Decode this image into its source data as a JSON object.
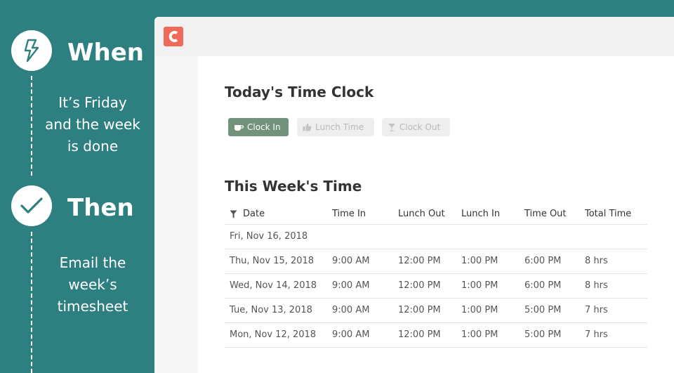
{
  "steps": [
    {
      "title": "When",
      "icon": "lightning-bolt-icon",
      "description": [
        "It’s Friday",
        "and the week",
        "is done"
      ]
    },
    {
      "title": "Then",
      "icon": "checkmark-icon",
      "description": [
        "Email the",
        "week’s",
        "timesheet"
      ]
    }
  ],
  "app": {
    "logo": "app-logo",
    "accent_color": "#f06a5b"
  },
  "today": {
    "title": "Today's Time Clock",
    "buttons": [
      {
        "label": "Clock In",
        "icon": "coffee-cup-icon",
        "enabled": true
      },
      {
        "label": "Lunch Time",
        "icon": "thumbs-up-icon",
        "enabled": false
      },
      {
        "label": "Clock Out",
        "icon": "cocktail-glass-icon",
        "enabled": false
      }
    ]
  },
  "week": {
    "title": "This Week's Time",
    "filter_icon": "filter-icon",
    "columns": [
      "Date",
      "Time In",
      "Lunch Out",
      "Lunch In",
      "Time Out",
      "Total Time"
    ],
    "rows": [
      [
        "Fri, Nov 16, 2018",
        "",
        "",
        "",
        "",
        ""
      ],
      [
        "Thu, Nov 15, 2018",
        "9:00 AM",
        "12:00 PM",
        "1:00 PM",
        "6:00 PM",
        "8 hrs"
      ],
      [
        "Wed, Nov 14, 2018",
        "9:00 AM",
        "12:00 PM",
        "1:00 PM",
        "6:00 PM",
        "8 hrs"
      ],
      [
        "Tue, Nov 13, 2018",
        "9:00 AM",
        "12:00 PM",
        "1:00 PM",
        "5:00 PM",
        "7 hrs"
      ],
      [
        "Mon, Nov 12, 2018",
        "9:00 AM",
        "12:00 PM",
        "1:00 PM",
        "5:00 PM",
        "7 hrs"
      ]
    ]
  },
  "colors": {
    "teal_background": "#2e8080",
    "primary_button": "#73927c",
    "disabled_button": "#eeeeee"
  }
}
